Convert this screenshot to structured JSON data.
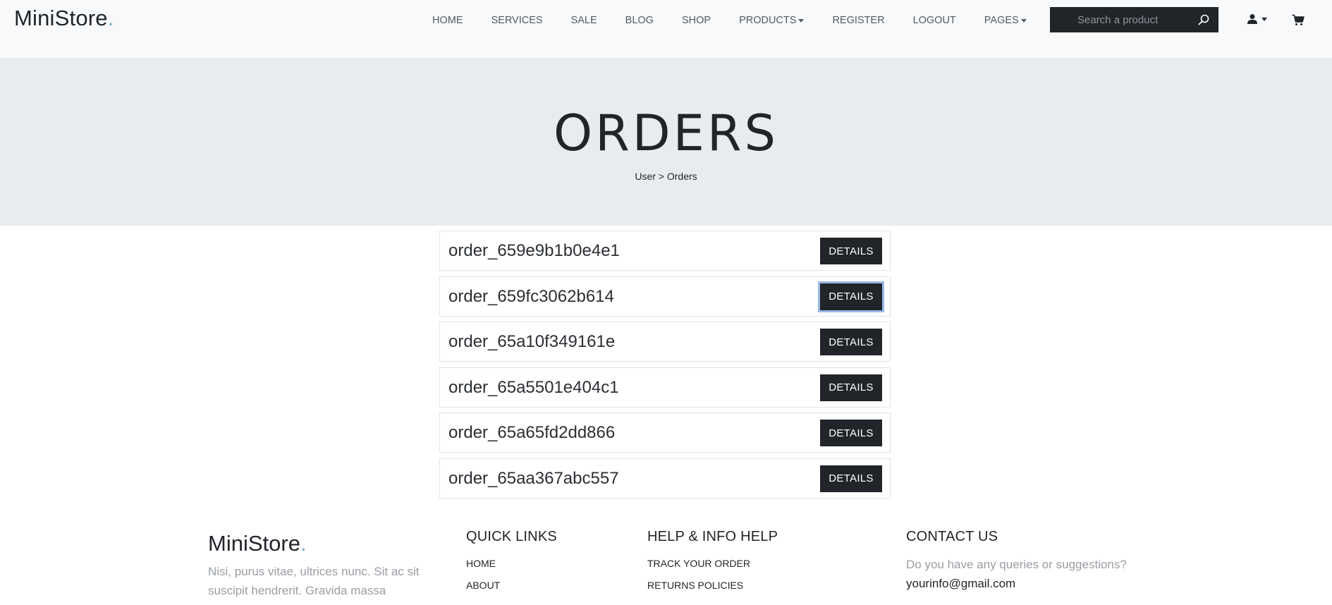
{
  "header": {
    "brand": "MiniStore",
    "brand_dot": ".",
    "nav": [
      {
        "label": "HOME",
        "dropdown": false
      },
      {
        "label": "SERVICES",
        "dropdown": false
      },
      {
        "label": "SALE",
        "dropdown": false
      },
      {
        "label": "BLOG",
        "dropdown": false
      },
      {
        "label": "SHOP",
        "dropdown": false
      },
      {
        "label": "PRODUCTS",
        "dropdown": true
      },
      {
        "label": "REGISTER",
        "dropdown": false
      },
      {
        "label": "LOGOUT",
        "dropdown": false
      },
      {
        "label": "PAGES",
        "dropdown": true
      }
    ],
    "search_placeholder": "Search a product",
    "search_value": "",
    "user_icon": "user-icon",
    "cart_icon": "cart-icon"
  },
  "hero": {
    "title": "ORDERS",
    "breadcrumb": "User > Orders"
  },
  "orders": {
    "button_label": "DETAILS",
    "items": [
      {
        "id": "order_659e9b1b0e4e1"
      },
      {
        "id": "order_659fc3062b614"
      },
      {
        "id": "order_65a10f349161e"
      },
      {
        "id": "order_65a5501e404c1"
      },
      {
        "id": "order_65a65fd2dd866"
      },
      {
        "id": "order_65aa367abc557"
      }
    ]
  },
  "footer": {
    "brand": "MiniStore",
    "brand_dot": ".",
    "about_text": "Nisi, purus vitae, ultrices nunc. Sit ac sit suscipit hendrerit. Gravida massa",
    "quick_links_title": "QUICK LINKS",
    "quick_links": [
      "HOME",
      "ABOUT"
    ],
    "help_title": "HELP & INFO HELP",
    "help_links": [
      "TRACK YOUR ORDER",
      "RETURNS POLICIES"
    ],
    "contact_title": "CONTACT US",
    "contact_question": "Do you have any queries or suggestions?",
    "contact_email": "yourinfo@gmail.com"
  },
  "colors": {
    "dark": "#212529",
    "accent": "#72aec8",
    "hero_bg": "#e8ecee",
    "nav_bg": "#f8f9fa"
  }
}
